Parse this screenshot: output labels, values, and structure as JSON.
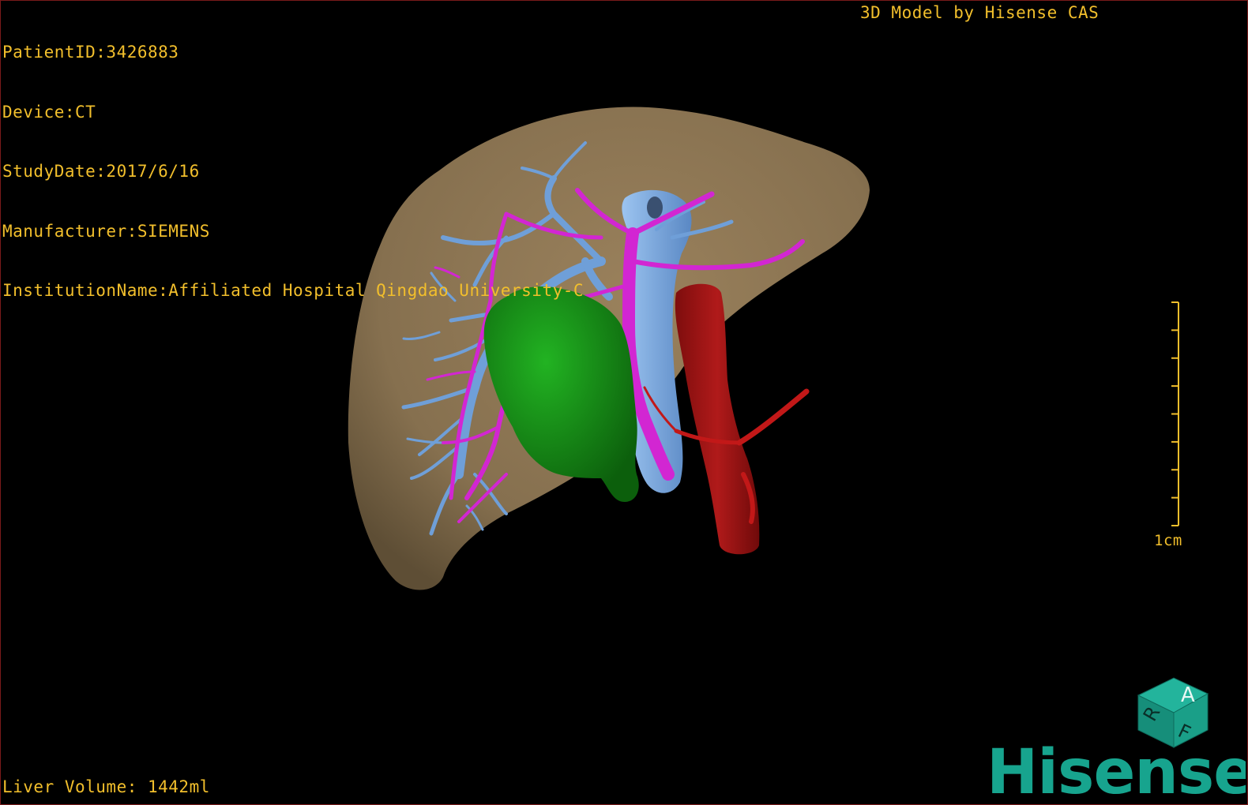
{
  "header": {
    "patient_id": "PatientID:3426883",
    "device": "Device:CT",
    "study_date": "StudyDate:2017/6/16",
    "manufacturer": "Manufacturer:SIEMENS",
    "institution": "InstitutionName:Affiliated Hospital Qingdao University-C",
    "model_credit": "3D Model by Hisense CAS"
  },
  "footer": {
    "liver_volume": "Liver Volume: 1442ml"
  },
  "scale_bar": {
    "label": "1cm",
    "tick_count": 9
  },
  "orientation_cube": {
    "labels": [
      "A",
      "R",
      "F"
    ]
  },
  "brand": {
    "name": "Hisense"
  },
  "colors": {
    "overlay_text": "#f2bf2c",
    "liver": "#8b7352",
    "portal_vein": "#6f9fd8",
    "hepatic_vein": "#d226d2",
    "tumor": "#1a9a1a",
    "aorta": "#a01414",
    "ivc": "#7aaee6",
    "brand": "#17a48e"
  }
}
